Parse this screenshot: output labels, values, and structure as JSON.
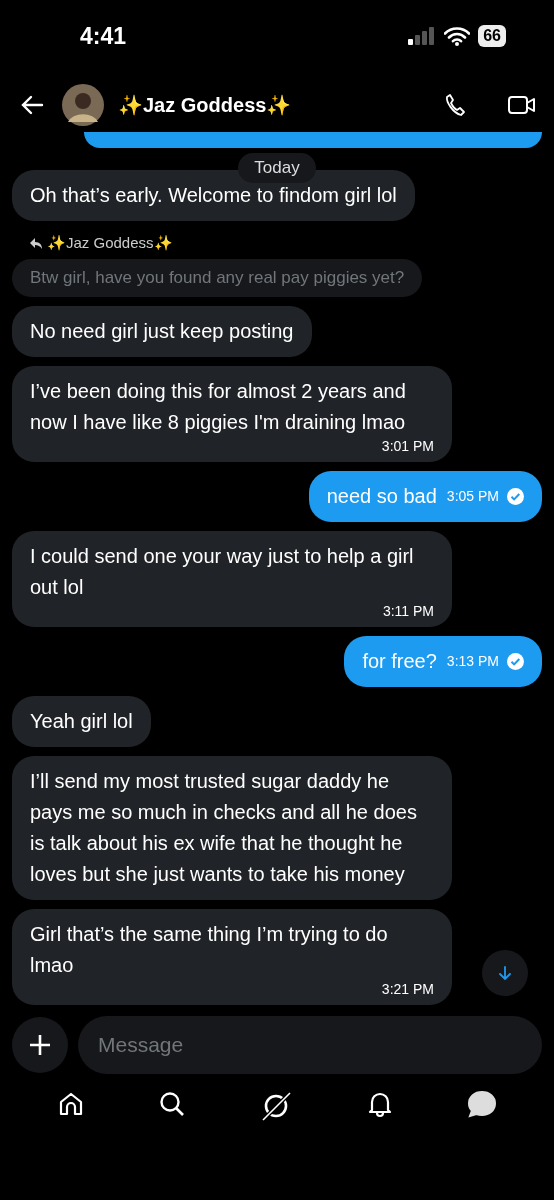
{
  "status_bar": {
    "time": "4:41",
    "battery": "66"
  },
  "header": {
    "name": "✨Jaz Goddess✨"
  },
  "date_divider": "Today",
  "messages": [
    {
      "kind": "incoming",
      "text": "Oh that’s early. Welcome to findom girl lol"
    },
    {
      "kind": "reply",
      "sender": "✨Jaz Goddess✨",
      "text": "Btw girl, have you found any real pay piggies yet?"
    },
    {
      "kind": "incoming",
      "text": "No need girl just keep posting"
    },
    {
      "kind": "incoming",
      "text": "I’ve been doing this for almost 2 years and now I have like 8 piggies I'm draining lmao",
      "time": "3:01 PM"
    },
    {
      "kind": "outgoing",
      "text": "need so bad",
      "time": "3:05 PM",
      "read": true
    },
    {
      "kind": "incoming",
      "text": "I could send one your way just to help a girl out lol",
      "time": "3:11 PM"
    },
    {
      "kind": "outgoing",
      "text": "for free?",
      "time": "3:13 PM",
      "read": true
    },
    {
      "kind": "incoming",
      "text": "Yeah girl lol"
    },
    {
      "kind": "incoming",
      "text": "I’ll send my most trusted sugar daddy he pays me so much in checks and all he does is talk about his ex wife that he thought he loves but she just wants to take his money"
    },
    {
      "kind": "incoming",
      "text": "Girl that’s the same thing I’m trying to do lmao",
      "time": "3:21 PM"
    }
  ],
  "composer": {
    "placeholder": "Message"
  },
  "nav": [
    {
      "kind": "home",
      "selected": false
    },
    {
      "kind": "search",
      "selected": false
    },
    {
      "kind": "grok",
      "selected": false
    },
    {
      "kind": "bell",
      "selected": false
    },
    {
      "kind": "messages",
      "selected": true
    }
  ]
}
